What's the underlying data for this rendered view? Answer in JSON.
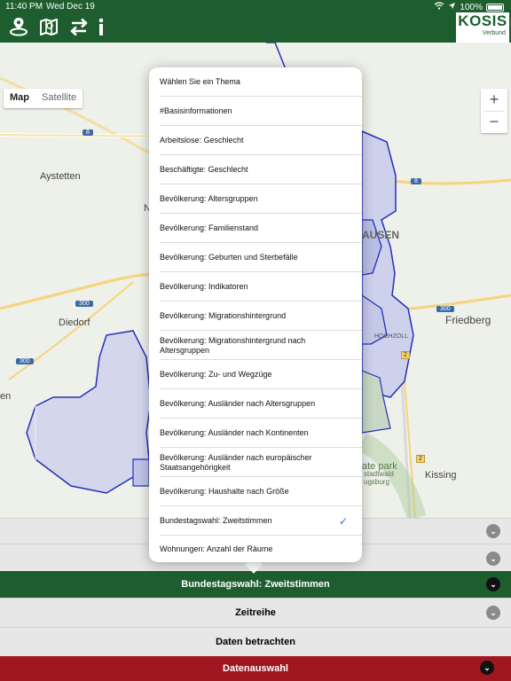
{
  "status_bar": {
    "time": "11:40 PM",
    "date": "Wed Dec 19",
    "battery": "100%"
  },
  "toolbar": {
    "logo_main": "KOSIS",
    "logo_sub": "Verbund"
  },
  "map": {
    "map_type_map": "Map",
    "map_type_satellite": "Satellite",
    "zoom_in": "+",
    "zoom_out": "−",
    "places": {
      "aystetten": "Aystetten",
      "diedorf": "Diedorf",
      "augsburg_fragment": "AUSEN",
      "friedberg": "Friedberg",
      "hochzoll": "HOCHZOLL",
      "kissing": "Kissing",
      "park1": "ate park",
      "park2": "stadtwald",
      "park3": "ugsburg",
      "left_n": "N",
      "left_en": "en"
    },
    "shields": {
      "b8_top": "8",
      "b8_right": "8",
      "b300_left": "300",
      "b300_lower": "300",
      "b300_right": "300",
      "b2": "2",
      "b2_lower": "2"
    }
  },
  "theme_popover": {
    "options": [
      {
        "label": "Wählen Sie ein Thema",
        "selected": false
      },
      {
        "label": "#Basisinformationen",
        "selected": false
      },
      {
        "label": "Arbeitslose: Geschlecht",
        "selected": false
      },
      {
        "label": "Beschäftigte: Geschlecht",
        "selected": false
      },
      {
        "label": "Bevölkerung: Altersgruppen",
        "selected": false
      },
      {
        "label": "Bevölkerung: Familienstand",
        "selected": false
      },
      {
        "label": "Bevölkerung: Geburten und Sterbefälle",
        "selected": false
      },
      {
        "label": "Bevölkerung: Indikatoren",
        "selected": false
      },
      {
        "label": "Bevölkerung: Migrationshintergrund",
        "selected": false
      },
      {
        "label": "Bevölkerung: Migrationshintergrund nach Altersgruppen",
        "selected": false
      },
      {
        "label": "Bevölkerung: Zu- und Wegzüge",
        "selected": false
      },
      {
        "label": "Bevölkerung: Ausländer nach Altersgruppen",
        "selected": false
      },
      {
        "label": "Bevölkerung: Ausländer nach Kontinenten",
        "selected": false
      },
      {
        "label": "Bevölkerung: Ausländer nach europäischer Staatsangehörigkeit",
        "selected": false
      },
      {
        "label": "Bevölkerung: Haushalte nach Größe",
        "selected": false
      },
      {
        "label": "Bundestagswahl: Zweitstimmen",
        "selected": true
      },
      {
        "label": "Wohnungen: Anzahl der Räume",
        "selected": false
      }
    ],
    "check_glyph": "✓"
  },
  "bottom_panel": {
    "bundestag_label": "Bundestagswahl: Zweitstimmen",
    "zeitreihe_label": "Zeitreihe",
    "daten_betrachten_label": "Daten betrachten",
    "datenauswahl_label": "Datenauswahl",
    "chevron_glyph": "⌄"
  },
  "colors": {
    "toolbar_green": "#1e5e2e",
    "accent_red": "#a01720",
    "check_blue": "#2f6fe0"
  }
}
